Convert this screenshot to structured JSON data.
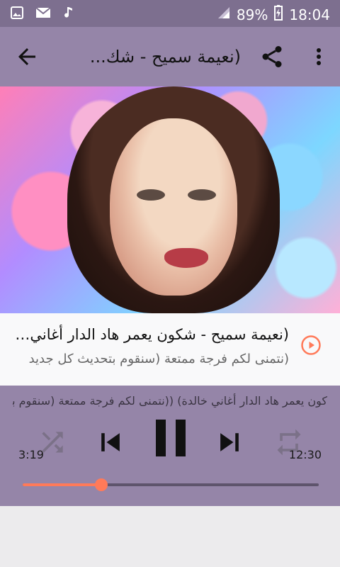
{
  "statusbar": {
    "battery_percent": "89%",
    "time": "18:04",
    "left_icons": [
      "image-icon",
      "mail-icon",
      "music-icon"
    ]
  },
  "appbar": {
    "title": "(نعيمة سميح - شك..."
  },
  "now_playing": {
    "title": "(نعيمة سميح - شكون يعمر هاد الدار أغاني ...",
    "subtitle": "(نتمنى لكم فرجة ممتعة (سنقوم بتحديث كل جديد"
  },
  "player": {
    "marquee": "كون يعمر هاد الدار أغاني خالدة) ((نتمنى لكم فرجة ممتعة (سنقوم بت",
    "elapsed": "3:19",
    "duration": "12:30",
    "progress_fraction": 0.265
  },
  "colors": {
    "statusbar": "#7d6f8f",
    "appbar": "#9585a8",
    "accent": "#ff7a59"
  }
}
